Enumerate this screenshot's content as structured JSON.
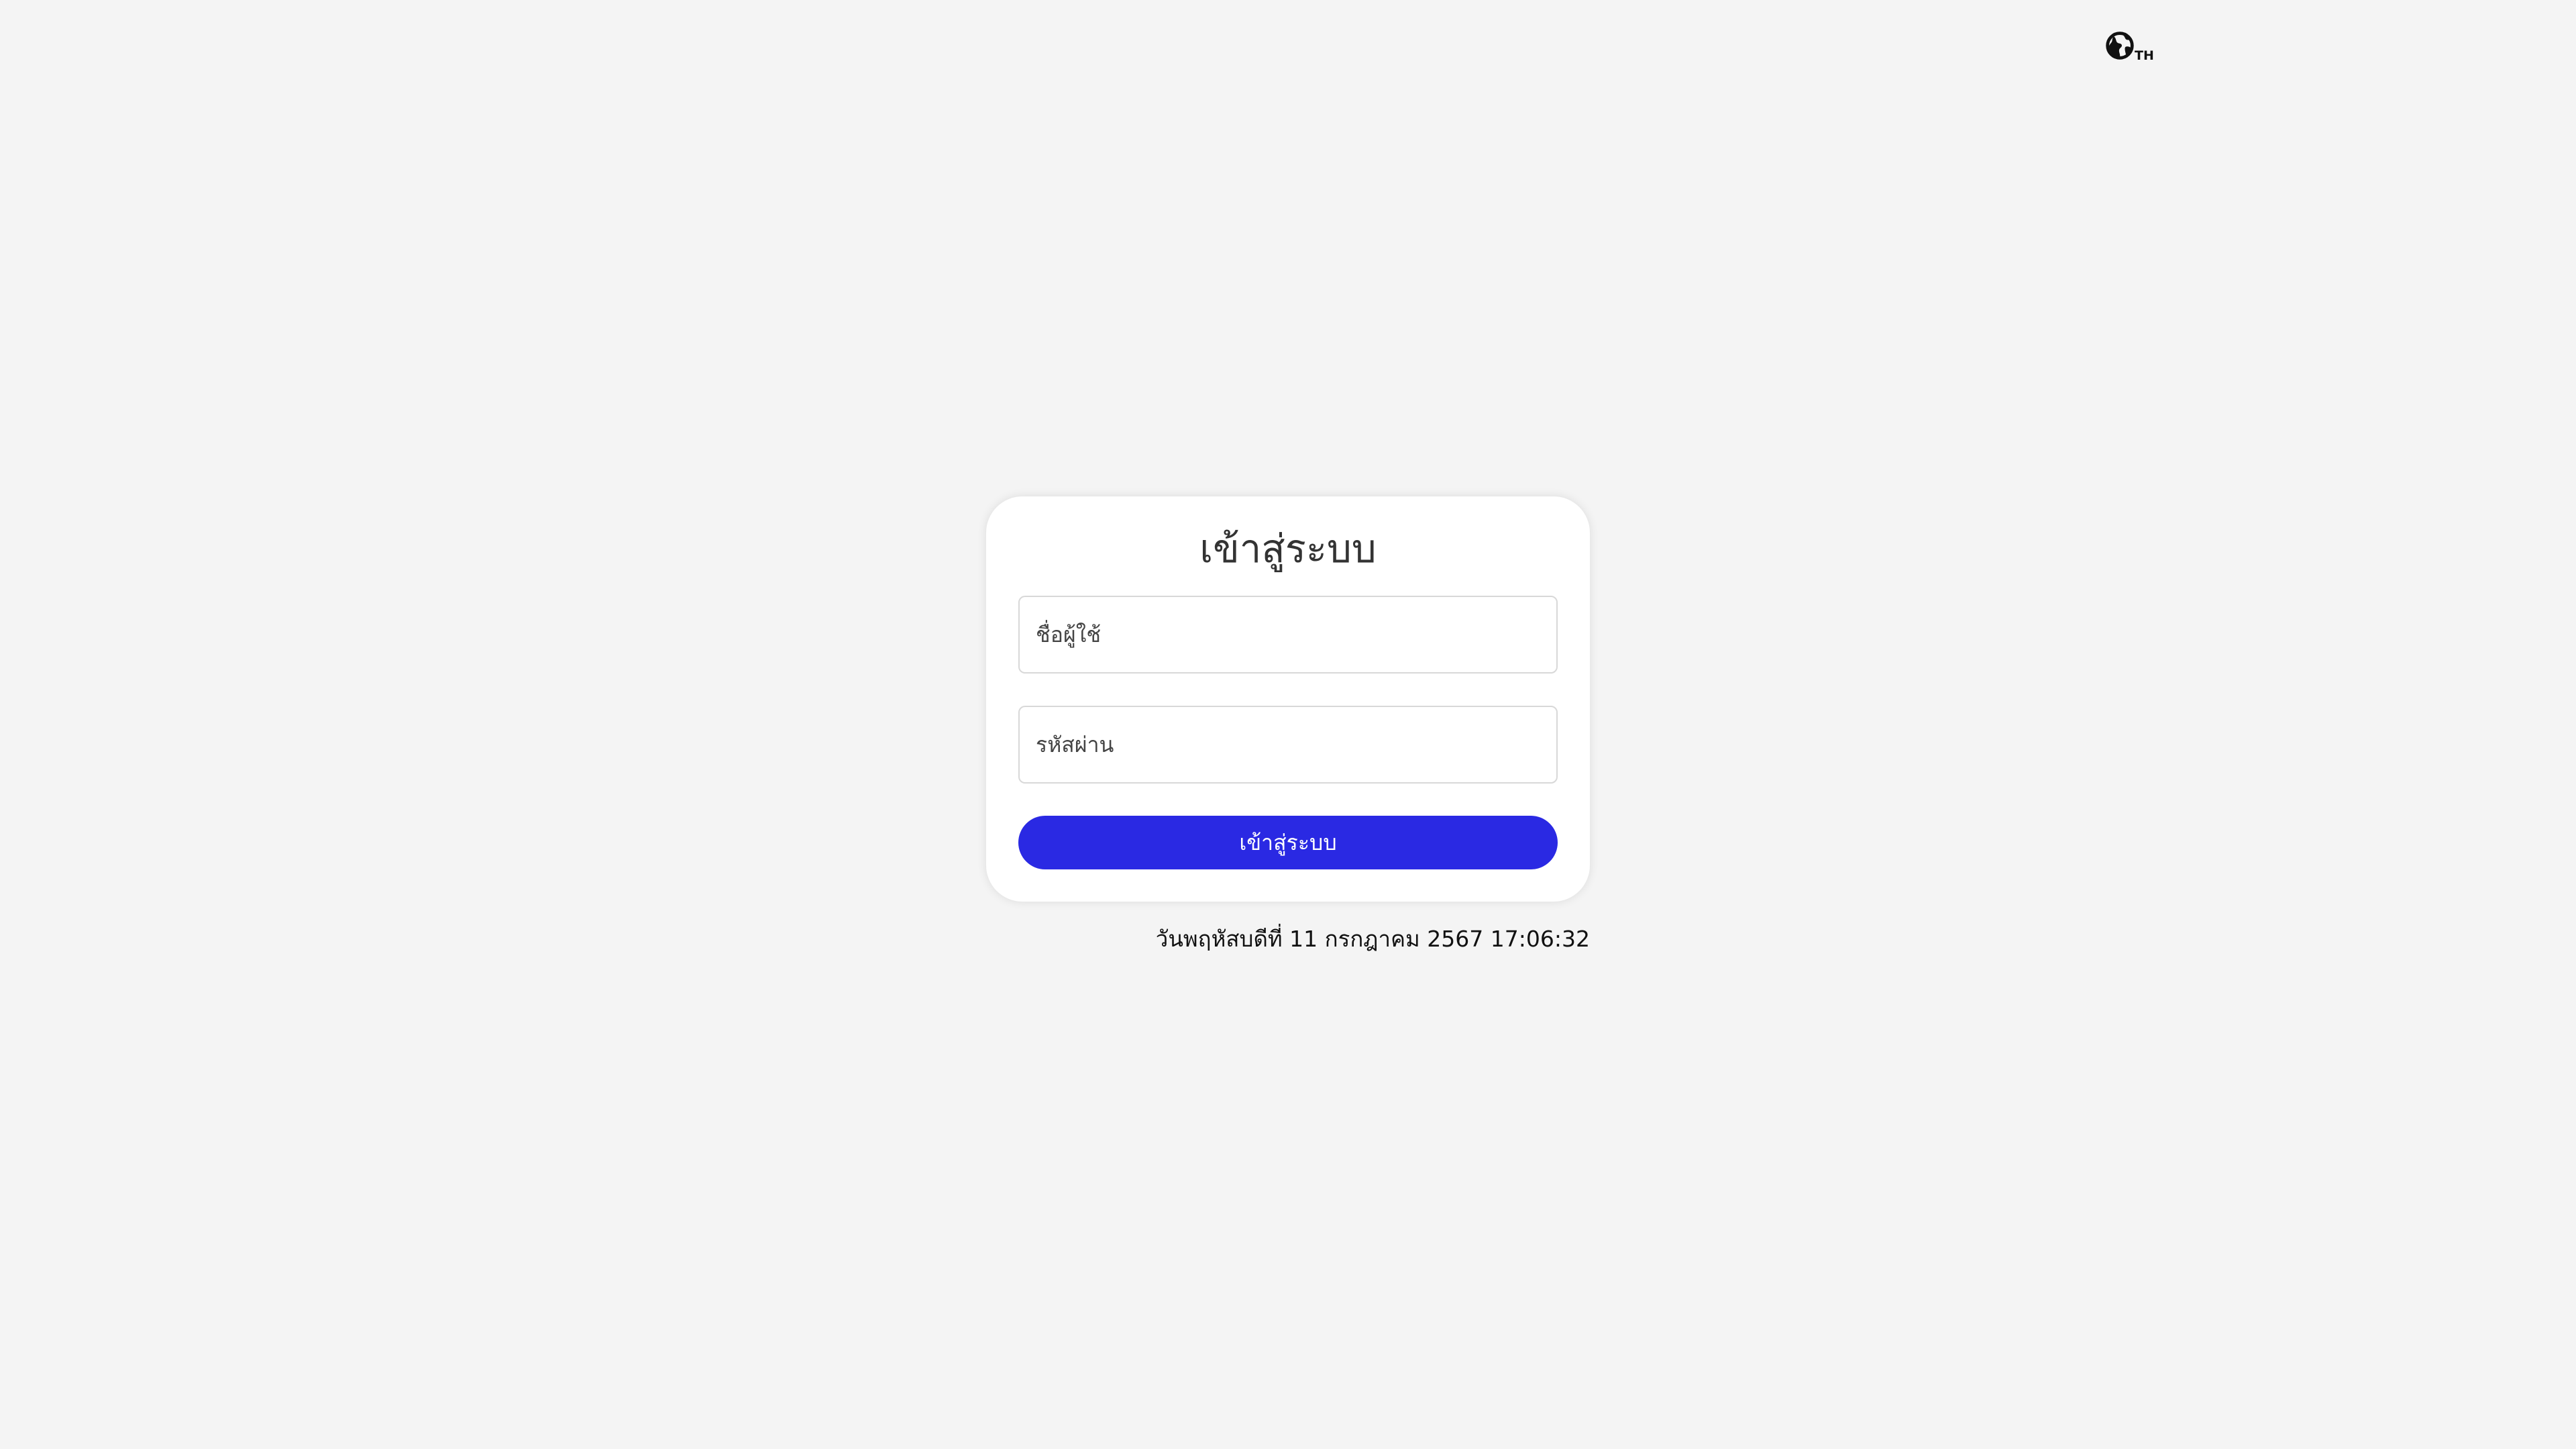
{
  "language": {
    "icon": "globe-icon",
    "code": "TH"
  },
  "login": {
    "title": "เข้าสู่ระบบ",
    "username": {
      "value": "",
      "placeholder": "ชื่อผู้ใช้"
    },
    "password": {
      "value": "",
      "placeholder": "รหัสผ่าน"
    },
    "submit_label": "เข้าสู่ระบบ"
  },
  "datetime": "วันพฤหัสบดีที่ 11 กรกฎาคม 2567 17:06:32",
  "colors": {
    "background": "#f4f4f4",
    "card": "#ffffff",
    "accent": "#2a29e3"
  }
}
